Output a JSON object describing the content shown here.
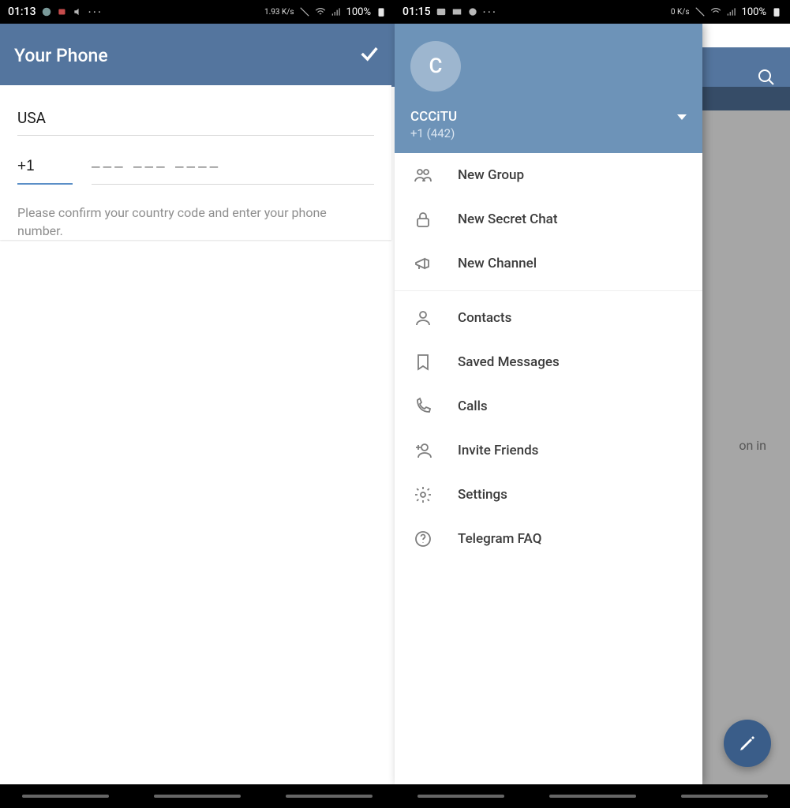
{
  "left": {
    "status": {
      "time": "01:13",
      "speed": "1.93 K/s",
      "battery": "100%"
    },
    "appbar_title": "Your Phone",
    "country": "USA",
    "code": "+1",
    "number_placeholder": "––– ––– ––––",
    "hint": "Please confirm your country code and enter your phone number."
  },
  "right": {
    "status": {
      "time": "01:15",
      "speed": "0 K/s",
      "battery": "100%"
    },
    "profile": {
      "initial": "C",
      "name": "CCCiTU",
      "phone": "+1 (442)"
    },
    "menu": {
      "new_group": "New Group",
      "new_secret": "New Secret Chat",
      "new_channel": "New Channel",
      "contacts": "Contacts",
      "saved": "Saved Messages",
      "calls": "Calls",
      "invite": "Invite Friends",
      "settings": "Settings",
      "faq": "Telegram FAQ"
    },
    "bg_text": "on in"
  }
}
